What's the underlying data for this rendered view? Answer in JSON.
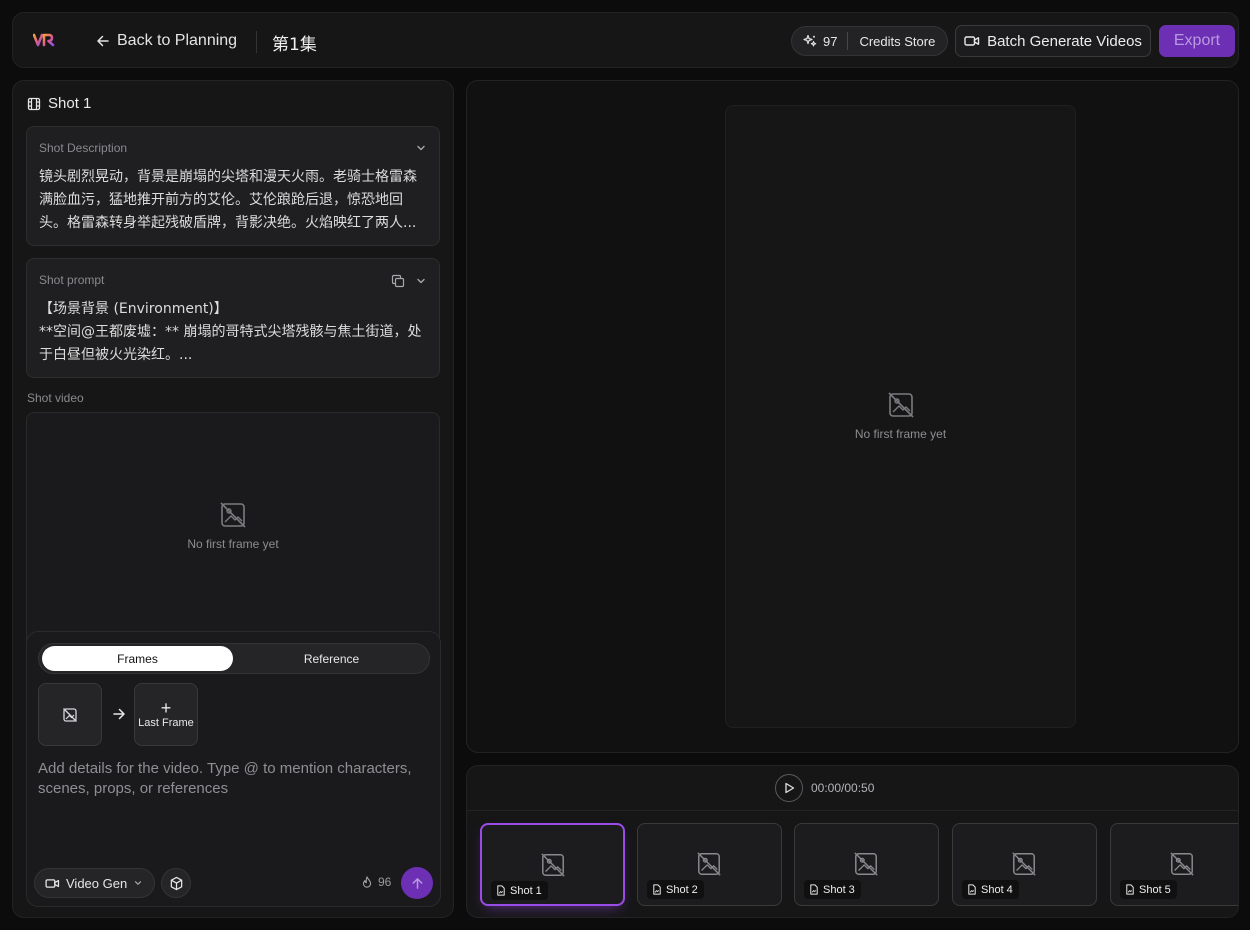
{
  "header": {
    "back_label": "Back to Planning",
    "episode_title": "第1集",
    "credits_count": "97",
    "credits_store_label": "Credits Store",
    "batch_label": "Batch Generate Videos",
    "export_label": "Export"
  },
  "shot_panel": {
    "title": "Shot 1",
    "description": {
      "label": "Shot Description",
      "lines": [
        "镜头剧烈晃动，背景是崩塌的尖塔和漫天火雨。老骑士格雷森",
        "满脸血污，猛地推开前方的艾伦。艾伦踉跄后退，惊恐地回",
        "头。格雷森转身举起残破盾牌，背影决绝。火焰映红了两人..."
      ]
    },
    "prompt": {
      "label": "Shot prompt",
      "lines": [
        "【场景背景 (Environment)】",
        "**空间@王都废墟：** 崩塌的哥特式尖塔残骸与焦土街道，处",
        "于白昼但被火光染红。..."
      ]
    },
    "video_label": "Shot video",
    "empty_text": "No first frame yet"
  },
  "composer": {
    "tabs": [
      "Frames",
      "Reference"
    ],
    "active_tab": "Frames",
    "last_frame_label": "Last Frame",
    "placeholder": "Add details for the video. Type @ to mention characters, scenes, props, or references",
    "mode_label": "Video Gen",
    "cost": "96"
  },
  "preview": {
    "empty_text": "No first frame yet"
  },
  "timeline": {
    "time": "00:00/00:50",
    "shots": [
      "Shot 1",
      "Shot 2",
      "Shot 3",
      "Shot 4",
      "Shot 5"
    ],
    "selected": "Shot 1"
  },
  "colors": {
    "accent": "#6d2fb4",
    "selected_border": "#9a4de6",
    "background": "#0c0c0d",
    "panel": "#161617"
  },
  "icons": [
    "vr-logo-icon",
    "arrow-left-icon",
    "sparkles-icon",
    "video-camera-icon",
    "film-icon",
    "chevron-down-icon",
    "copy-icon",
    "no-image-icon",
    "arrow-right-icon",
    "cube-icon",
    "fire-icon",
    "arrow-up-icon",
    "play-icon",
    "image-file-icon"
  ]
}
